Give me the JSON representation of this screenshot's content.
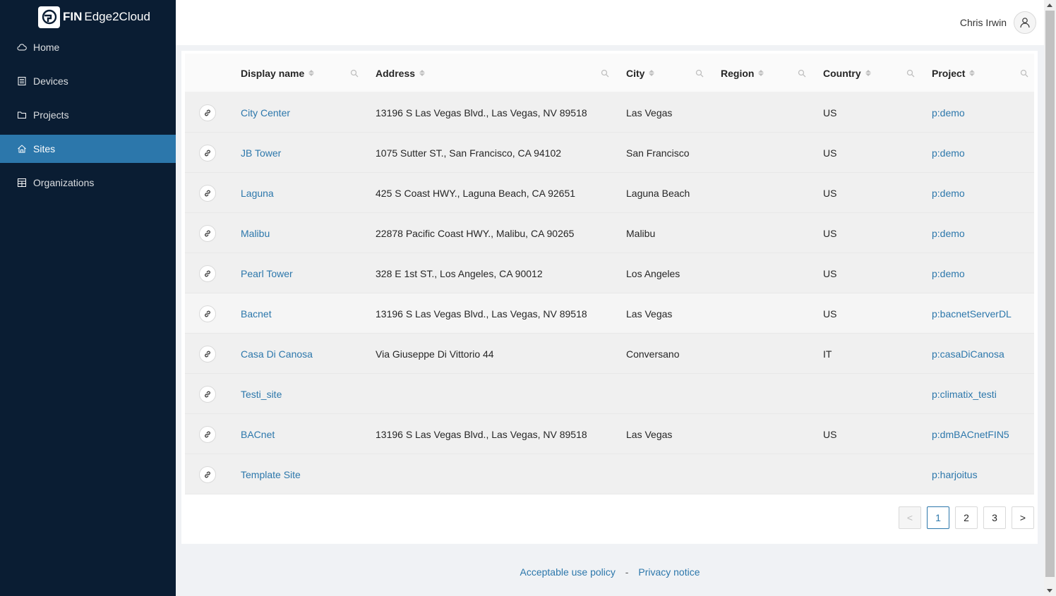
{
  "app": {
    "brand_bold": "FIN",
    "brand_rest": "Edge2Cloud"
  },
  "nav": [
    {
      "label": "Home",
      "icon": "cloud-icon"
    },
    {
      "label": "Devices",
      "icon": "device-icon"
    },
    {
      "label": "Projects",
      "icon": "folder-icon"
    },
    {
      "label": "Sites",
      "icon": "house-icon",
      "active": true
    },
    {
      "label": "Organizations",
      "icon": "building-icon"
    }
  ],
  "header": {
    "user_name": "Chris Irwin"
  },
  "table": {
    "columns": {
      "display_name": "Display name",
      "address": "Address",
      "city": "City",
      "region": "Region",
      "country": "Country",
      "project": "Project"
    },
    "rows": [
      {
        "name": "City Center",
        "address": "13196 S Las Vegas Blvd., Las Vegas, NV 89518",
        "city": "Las Vegas",
        "region": "",
        "country": "US",
        "project": "p:demo"
      },
      {
        "name": "JB Tower",
        "address": "1075 Sutter ST., San Francisco, CA 94102",
        "city": "San Francisco",
        "region": "",
        "country": "US",
        "project": "p:demo"
      },
      {
        "name": "Laguna",
        "address": "425 S Coast HWY., Laguna Beach, CA 92651",
        "city": "Laguna Beach",
        "region": "",
        "country": "US",
        "project": "p:demo"
      },
      {
        "name": "Malibu",
        "address": "22878 Pacific Coast HWY., Malibu, CA 90265",
        "city": "Malibu",
        "region": "",
        "country": "US",
        "project": "p:demo"
      },
      {
        "name": "Pearl Tower",
        "address": "328 E 1st ST., Los Angeles, CA 90012",
        "city": "Los Angeles",
        "region": "",
        "country": "US",
        "project": "p:demo"
      },
      {
        "name": "Bacnet",
        "address": "13196 S Las Vegas Blvd., Las Vegas, NV 89518",
        "city": "Las Vegas",
        "region": "",
        "country": "US",
        "project": "p:bacnetServerDL"
      },
      {
        "name": "Casa Di Canosa",
        "address": "Via Giuseppe Di Vittorio 44",
        "city": "Conversano",
        "region": "",
        "country": "IT",
        "project": "p:casaDiCanosa"
      },
      {
        "name": "Testi_site",
        "address": "",
        "city": "",
        "region": "",
        "country": "",
        "project": "p:climatix_testi"
      },
      {
        "name": "BACnet",
        "address": "13196 S Las Vegas Blvd., Las Vegas, NV 89518",
        "city": "Las Vegas",
        "region": "",
        "country": "US",
        "project": "p:dmBACnetFIN5"
      },
      {
        "name": "Template Site",
        "address": "",
        "city": "",
        "region": "",
        "country": "",
        "project": "p:harjoitus"
      }
    ]
  },
  "pagination": {
    "prev": "<",
    "pages": [
      "1",
      "2",
      "3"
    ],
    "current": "1",
    "next": ">"
  },
  "footer": {
    "acceptable_use": "Acceptable use policy",
    "separator": "-",
    "privacy": "Privacy notice"
  },
  "colors": {
    "sidebar_bg": "#0a1d33",
    "active_nav": "#2c77ab",
    "link": "#2c77ab"
  }
}
